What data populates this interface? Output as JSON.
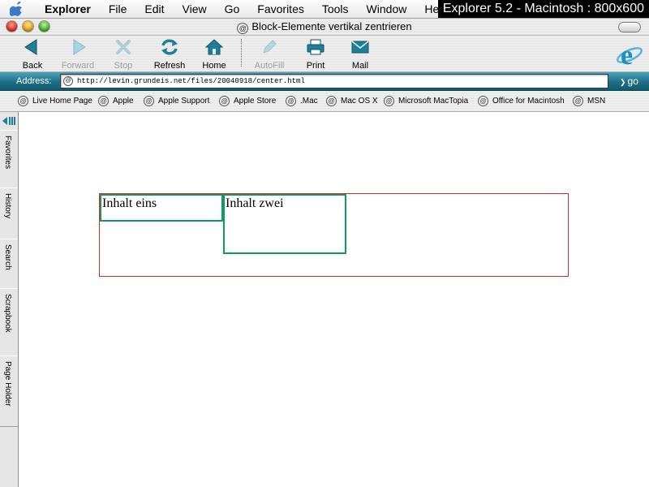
{
  "menubar": {
    "app": "Explorer",
    "items": [
      "File",
      "Edit",
      "View",
      "Go",
      "Favorites",
      "Tools",
      "Window",
      "He"
    ]
  },
  "overlay_label": "Explorer 5.2 - Macintosh : 800x600",
  "window": {
    "title": "Block-Elemente vertikal zentrieren"
  },
  "toolbar": {
    "back": "Back",
    "forward": "Forward",
    "stop": "Stop",
    "refresh": "Refresh",
    "home": "Home",
    "autofill": "AutoFill",
    "print": "Print",
    "mail": "Mail"
  },
  "address": {
    "label": "Address:",
    "url": "http://levin.grundeis.net/files/20040918/center.html",
    "go": "go"
  },
  "favorites": [
    "Live Home Page",
    "Apple",
    "Apple Support",
    "Apple Store",
    ".Mac",
    "Mac OS X",
    "Microsoft MacTopia",
    "Office for Macintosh",
    "MSN"
  ],
  "sidebar_tabs": [
    "Favorites",
    "History",
    "Search",
    "Scrapbook",
    "Page Holder"
  ],
  "content": {
    "box1": "Inhalt eins",
    "box2": "Inhalt zwei"
  },
  "colors": {
    "accent": "#1d6f86",
    "outer_border": "#d22b2b",
    "box_border": "#0f9a62"
  }
}
